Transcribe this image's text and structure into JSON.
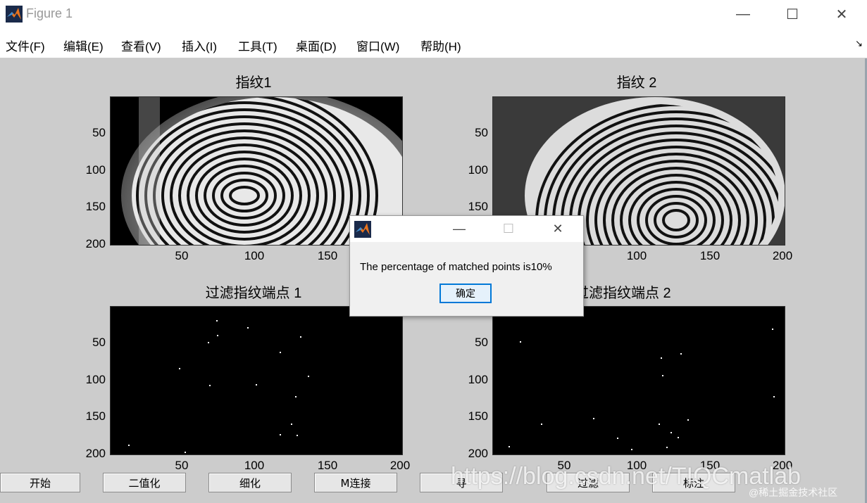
{
  "window": {
    "title": "Figure 1",
    "minimize_glyph": "—",
    "maximize_glyph": "☐",
    "close_glyph": "✕"
  },
  "menu": {
    "items": [
      "文件(F)",
      "编辑(E)",
      "查看(V)",
      "插入(I)",
      "工具(T)",
      "桌面(D)",
      "窗口(W)",
      "帮助(H)"
    ],
    "overflow_glyph": "↘"
  },
  "axes": [
    {
      "title": "指纹1",
      "yticks": [
        "50",
        "100",
        "150",
        "200"
      ],
      "xticks": [
        "50",
        "100",
        "150"
      ],
      "content": "fingerprint-image"
    },
    {
      "title": "指纹 2",
      "yticks": [
        "50",
        "100",
        "150"
      ],
      "xticks": [
        "100",
        "150",
        "200"
      ],
      "content": "fingerprint-image"
    },
    {
      "title": "过滤指纹端点 1",
      "yticks": [
        "50",
        "100",
        "150",
        "200"
      ],
      "xticks": [
        "50",
        "100",
        "150",
        "200"
      ],
      "content": "minutiae-points"
    },
    {
      "title": "过滤指纹端点 2",
      "yticks": [
        "50",
        "100",
        "150",
        "200"
      ],
      "xticks": [
        "50",
        "100",
        "150",
        "200"
      ],
      "content": "minutiae-points"
    }
  ],
  "buttons": [
    {
      "label": "开始"
    },
    {
      "label": "二值化"
    },
    {
      "label": "细化"
    },
    {
      "label": "M连接"
    },
    {
      "label": "寻"
    },
    {
      "label": "过滤"
    },
    {
      "label": "标注"
    }
  ],
  "dialog": {
    "message": "The percentage of matched points is10%",
    "ok_label": "确定",
    "minimize_glyph": "—",
    "maximize_glyph": "☐",
    "close_glyph": "✕"
  },
  "watermark": {
    "url": "https://blog.csdn.net/TIQCmatlab",
    "community": "@稀土掘金技术社区"
  },
  "colors": {
    "figure_bg": "#cccccc",
    "dialog_accent": "#0078d7",
    "matlab_orange": "#e9731c"
  }
}
